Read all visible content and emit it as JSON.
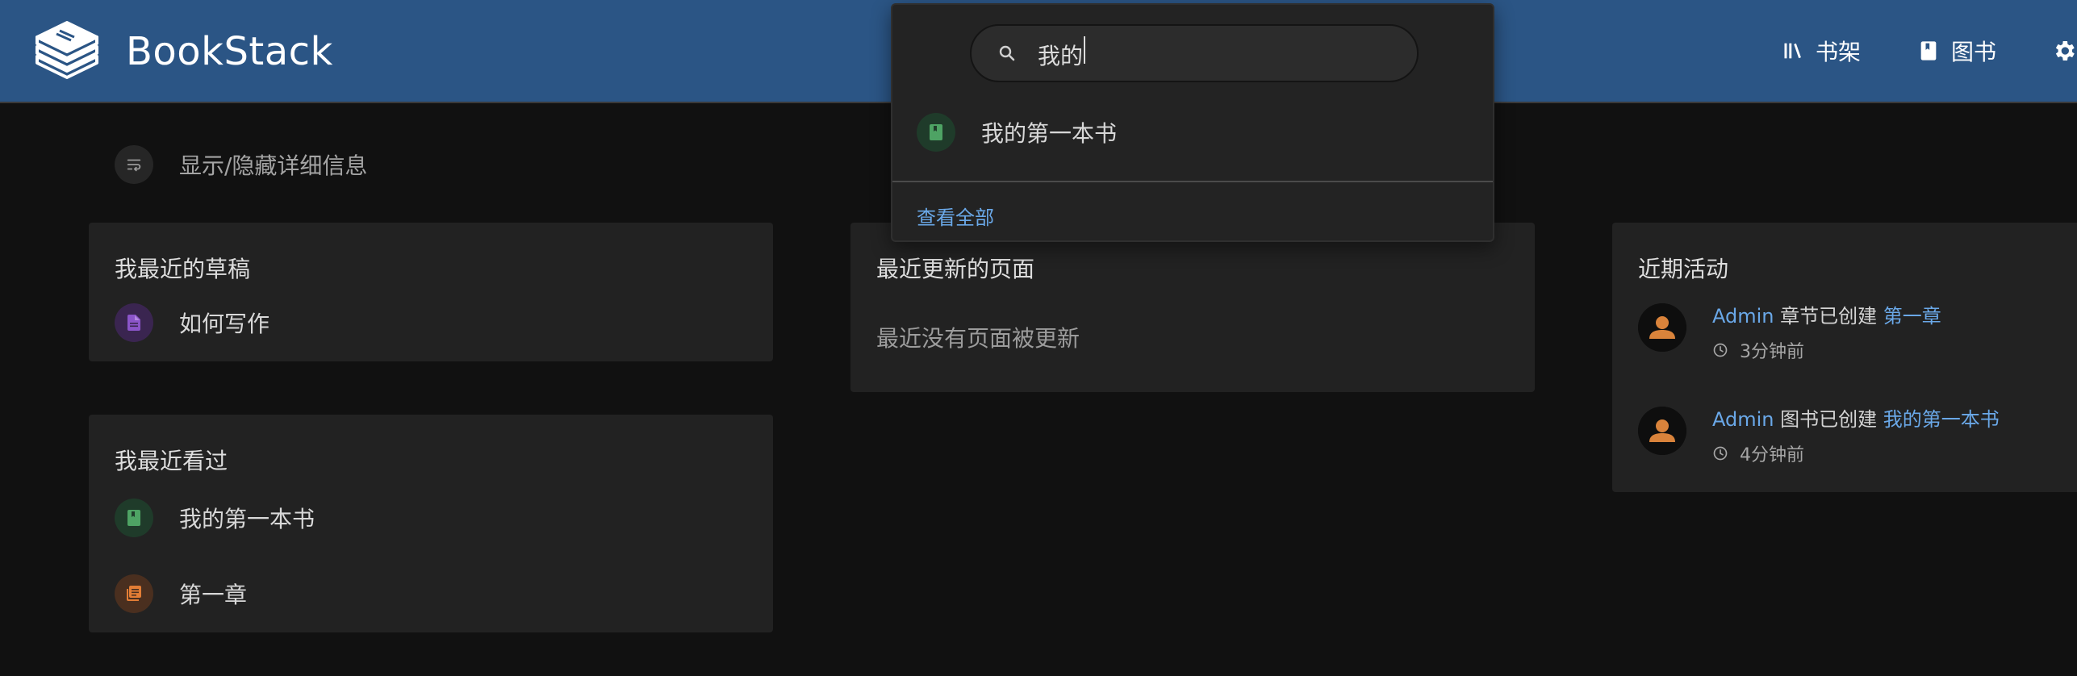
{
  "app": {
    "title": "BookStack"
  },
  "nav": {
    "shelves": "书架",
    "books": "图书"
  },
  "search": {
    "query": "我的",
    "results": [
      {
        "type": "book",
        "label": "我的第一本书"
      }
    ],
    "view_all": "查看全部"
  },
  "toggle_details": {
    "label": "显示/隐藏详细信息"
  },
  "drafts": {
    "title": "我最近的草稿",
    "items": [
      {
        "type": "page",
        "label": "如何写作"
      }
    ]
  },
  "recently_viewed": {
    "title": "我最近看过",
    "items": [
      {
        "type": "book",
        "label": "我的第一本书"
      },
      {
        "type": "chapter",
        "label": "第一章"
      }
    ]
  },
  "recently_updated": {
    "title": "最近更新的页面",
    "empty": "最近没有页面被更新"
  },
  "activity": {
    "title": "近期活动",
    "items": [
      {
        "user": "Admin",
        "action": "章节已创建",
        "target": "第一章",
        "time": "3分钟前"
      },
      {
        "user": "Admin",
        "action": "图书已创建",
        "target": "我的第一本书",
        "time": "4分钟前"
      }
    ]
  },
  "colors": {
    "header": "#2b5585",
    "link": "#6aa8e8",
    "book": "#4ea364",
    "page": "#8b55c9",
    "chapter": "#e37d35",
    "avatar": "#d9833b"
  }
}
